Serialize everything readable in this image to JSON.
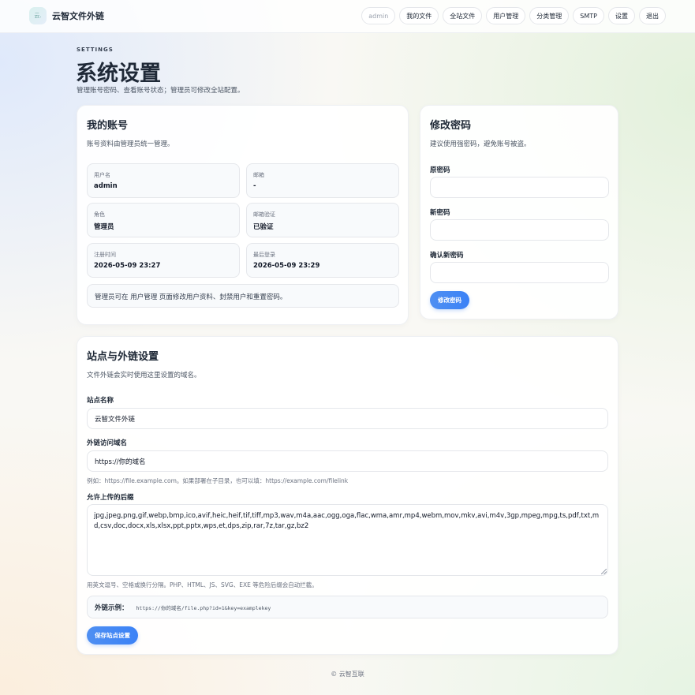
{
  "header": {
    "logo_text": "云.",
    "brand": "云智文件外链",
    "nav": [
      {
        "label": "admin"
      },
      {
        "label": "我的文件"
      },
      {
        "label": "全站文件"
      },
      {
        "label": "用户管理"
      },
      {
        "label": "分类管理"
      },
      {
        "label": "SMTP"
      },
      {
        "label": "设置"
      },
      {
        "label": "退出"
      }
    ]
  },
  "page": {
    "eyebrow": "SETTINGS",
    "title": "系统设置",
    "subtitle": "管理账号密码、查看账号状态；管理员可修改全站配置。"
  },
  "account": {
    "title": "我的账号",
    "desc": "账号资料由管理员统一管理。",
    "fields": [
      {
        "label": "用户名",
        "value": "admin"
      },
      {
        "label": "邮箱",
        "value": "-"
      },
      {
        "label": "角色",
        "value": "管理员"
      },
      {
        "label": "邮箱验证",
        "value": "已验证"
      },
      {
        "label": "注册时间",
        "value": "2026-05-09 23:27"
      },
      {
        "label": "最后登录",
        "value": "2026-05-09 23:29"
      }
    ],
    "note": "管理员可在 用户管理 页面修改用户资料、封禁用户和重置密码。"
  },
  "password": {
    "title": "修改密码",
    "desc": "建议使用强密码，避免账号被盗。",
    "old_label": "原密码",
    "new_label": "新密码",
    "confirm_label": "确认新密码",
    "old_value": "",
    "new_value": "",
    "confirm_value": "",
    "submit": "修改密码"
  },
  "site": {
    "title": "站点与外链设置",
    "desc": "文件外链会实时使用这里设置的域名。",
    "name_label": "站点名称",
    "name_value": "云智文件外链",
    "domain_label": "外链访问域名",
    "domain_value": "https://你的域名",
    "domain_hint": "例如：https://file.example.com。如果部署在子目录，也可以填：https://example.com/filelink",
    "ext_label": "允许上传的后缀",
    "ext_value": "jpg,jpeg,png,gif,webp,bmp,ico,avif,heic,heif,tif,tiff,mp3,wav,m4a,aac,ogg,oga,flac,wma,amr,mp4,webm,mov,mkv,avi,m4v,3gp,mpeg,mpg,ts,pdf,txt,md,csv,doc,docx,xls,xlsx,ppt,pptx,wps,et,dps,zip,rar,7z,tar,gz,bz2",
    "ext_hint": "用英文逗号、空格或换行分隔。PHP、HTML、JS、SVG、EXE 等危险后缀会自动拦截。",
    "example_label": "外链示例：",
    "example_value": "https://你的域名/file.php?id=1&key=examplekey",
    "submit": "保存站点设置"
  },
  "footer": "© 云智互联"
}
